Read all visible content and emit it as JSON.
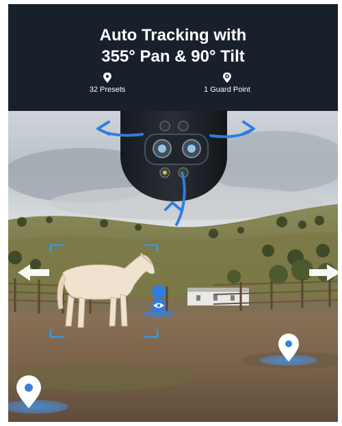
{
  "header": {
    "title_line1": "Auto Tracking with",
    "title_line2": "355° Pan & 90° Tilt",
    "stats": [
      {
        "label": "32 Presets",
        "icon": "location-pin-icon"
      },
      {
        "label": "1 Guard Point",
        "icon": "target-pin-icon"
      }
    ]
  },
  "colors": {
    "header_bg": "#18202c",
    "accent_blue": "#2f7de1",
    "marker_blue": "#3b82d6"
  },
  "scene": {
    "subject": "horse",
    "overlay_icons": [
      "pan-arrow-left-icon",
      "pan-arrow-right-icon",
      "tilt-arrow-down-icon",
      "white-arrow-left-icon",
      "white-arrow-right-icon",
      "eye-marker-icon",
      "location-marker-icon"
    ]
  }
}
